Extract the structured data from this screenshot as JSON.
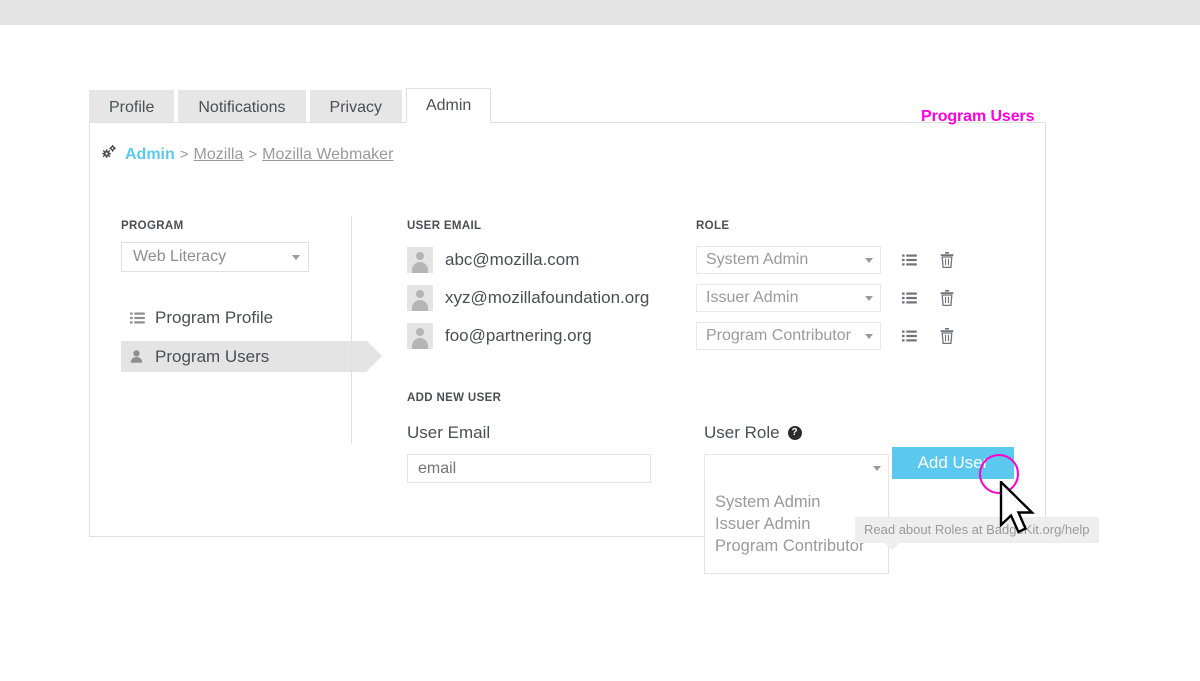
{
  "tabs": [
    {
      "label": "Profile",
      "active": false
    },
    {
      "label": "Notifications",
      "active": false
    },
    {
      "label": "Privacy",
      "active": false
    },
    {
      "label": "Admin",
      "active": true
    }
  ],
  "breadcrumb": {
    "icon": "gears-icon",
    "root": "Admin",
    "separator": ">",
    "items": [
      "Mozilla",
      "Mozilla Webmaker"
    ]
  },
  "sidebar": {
    "program_label": "PROGRAM",
    "program_select": {
      "value": "Web Literacy",
      "options": [
        "Web Literacy"
      ]
    },
    "items": [
      {
        "label": "Program Profile",
        "icon": "list-icon",
        "active": false
      },
      {
        "label": "Program Users",
        "icon": "user-icon",
        "active": true
      }
    ]
  },
  "users_table": {
    "columns": {
      "email": "USER EMAIL",
      "role": "ROLE"
    },
    "rows": [
      {
        "avatar": "avatar-placeholder",
        "email": "abc@mozilla.com",
        "role": "System Admin",
        "actions": [
          "details-icon",
          "trash-icon"
        ]
      },
      {
        "avatar": "avatar-placeholder",
        "email": "xyz@mozillafoundation.org",
        "role": "Issuer Admin",
        "actions": [
          "details-icon",
          "trash-icon"
        ]
      },
      {
        "avatar": "avatar-placeholder",
        "email": "foo@partnering.org",
        "role": "Program Contributor",
        "actions": [
          "details-icon",
          "trash-icon"
        ]
      }
    ]
  },
  "add_new_user": {
    "title": "ADD NEW USER",
    "email_label": "User Email",
    "email_placeholder": "email",
    "email_value": "",
    "role_label": "User Role",
    "help_icon": "question-mark-icon",
    "role_value": "",
    "role_options": [
      "System Admin",
      "Issuer Admin",
      "Program Contributor"
    ],
    "submit_label": "Add User",
    "tooltip": "Read about Roles at BadgeKit.org/help"
  },
  "annotations": {
    "callout_label": "Program Users",
    "callout_color": "#ff00e0",
    "highlight_color": "#ff00cc",
    "cursor": "arrow-cursor"
  },
  "theme": {
    "accent": "#5bc8f0",
    "panel_border": "#e0e0e0",
    "topbar": "#e4e4e4",
    "text": "#4a4f54",
    "muted": "#9a9a9a"
  }
}
